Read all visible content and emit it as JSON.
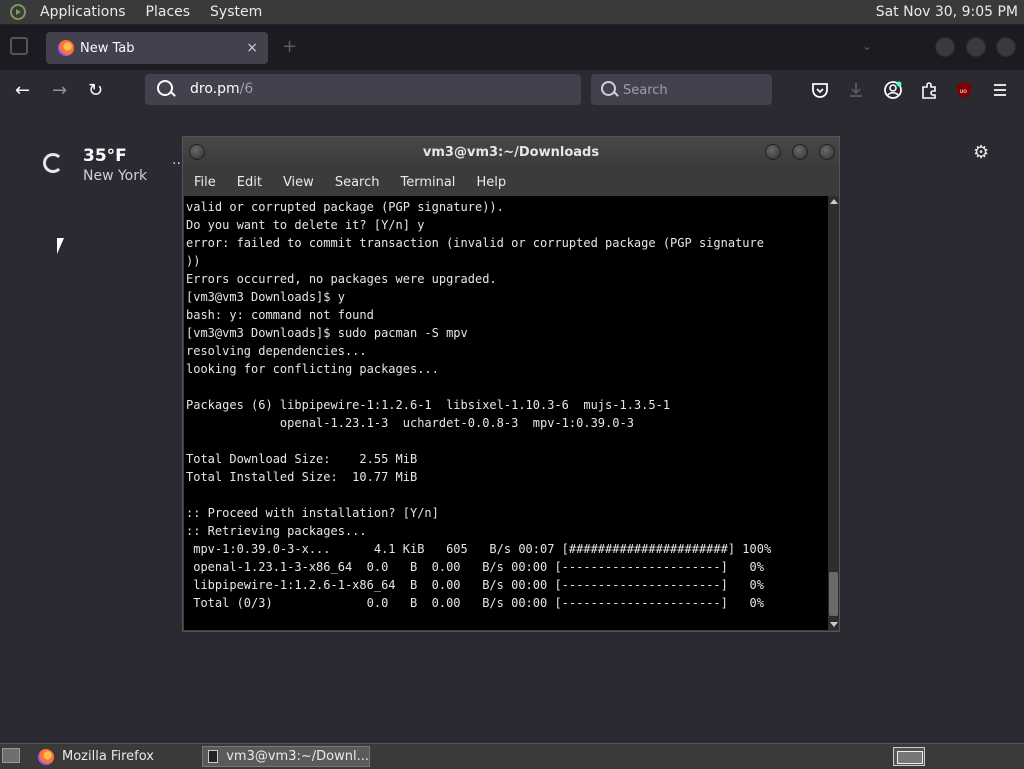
{
  "top_panel": {
    "menus": [
      "Applications",
      "Places",
      "System"
    ],
    "clock": "Sat Nov 30,  9:05 PM"
  },
  "browser": {
    "tab": {
      "title": "New Tab",
      "close": "×"
    },
    "new_tab_symbol": "+",
    "url": {
      "host": "dro.pm",
      "path": "/6"
    },
    "search": {
      "placeholder": "Search"
    },
    "weather": {
      "temp": "35°F",
      "city": "New York",
      "more": ".."
    }
  },
  "terminal": {
    "title": "vm3@vm3:~/Downloads",
    "menu": [
      "File",
      "Edit",
      "View",
      "Search",
      "Terminal",
      "Help"
    ],
    "lines": [
      "valid or corrupted package (PGP signature)).",
      "Do you want to delete it? [Y/n] y",
      "error: failed to commit transaction (invalid or corrupted package (PGP signature",
      "))",
      "Errors occurred, no packages were upgraded.",
      "[vm3@vm3 Downloads]$ y",
      "bash: y: command not found",
      "[vm3@vm3 Downloads]$ sudo pacman -S mpv",
      "resolving dependencies...",
      "looking for conflicting packages...",
      "",
      "Packages (6) libpipewire-1:1.2.6-1  libsixel-1.10.3-6  mujs-1.3.5-1",
      "             openal-1.23.1-3  uchardet-0.0.8-3  mpv-1:0.39.0-3",
      "",
      "Total Download Size:    2.55 MiB",
      "Total Installed Size:  10.77 MiB",
      "",
      ":: Proceed with installation? [Y/n]",
      ":: Retrieving packages...",
      " mpv-1:0.39.0-3-x...      4.1 KiB   605   B/s 00:07 [######################] 100%",
      " openal-1.23.1-3-x86_64  0.0   B  0.00   B/s 00:00 [----------------------]   0%",
      " libpipewire-1:1.2.6-1-x86_64  B  0.00   B/s 00:00 [----------------------]   0%",
      " Total (0/3)             0.0   B  0.00   B/s 00:00 [----------------------]   0%"
    ]
  },
  "taskbar": {
    "items": [
      "Mozilla Firefox",
      "vm3@vm3:~/Downl..."
    ]
  },
  "colors": {
    "firefox_bg": "#2b2a33",
    "panel": "#3a3a3a",
    "terminal_bg": "#000000"
  }
}
